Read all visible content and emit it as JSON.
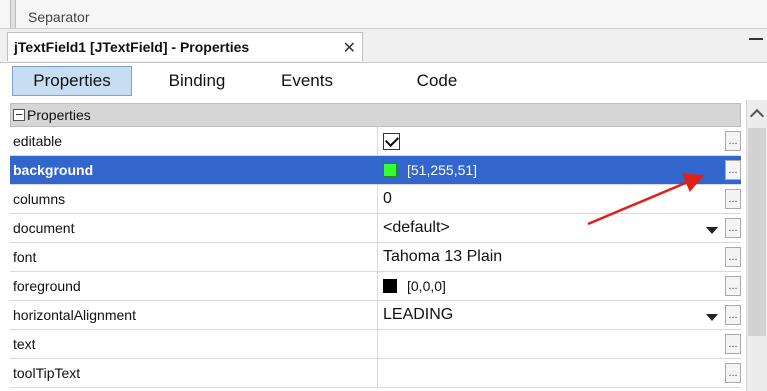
{
  "top_strip": {
    "cut_label": "Separator"
  },
  "window_tab": {
    "title": "jTextField1 [JTextField] - Properties",
    "close": "✕"
  },
  "sub_tabs": [
    {
      "label": "Properties",
      "active": true
    },
    {
      "label": "Binding",
      "active": false
    },
    {
      "label": "Events",
      "active": false
    },
    {
      "label": "Code",
      "active": false
    }
  ],
  "section": {
    "title": "Properties"
  },
  "rows": [
    {
      "name": "editable",
      "value": "",
      "type": "checkbox",
      "checked": true
    },
    {
      "name": "background",
      "value": "[51,255,51]",
      "type": "color",
      "color": "#33ff33",
      "selected": true
    },
    {
      "name": "columns",
      "value": "0",
      "type": "text"
    },
    {
      "name": "document",
      "value": "<default>",
      "type": "dropdown"
    },
    {
      "name": "font",
      "value": "Tahoma 13 Plain",
      "type": "text"
    },
    {
      "name": "foreground",
      "value": "[0,0,0]",
      "type": "color",
      "color": "#000000"
    },
    {
      "name": "horizontalAlignment",
      "value": "LEADING",
      "type": "dropdown"
    },
    {
      "name": "text",
      "value": "",
      "type": "text"
    },
    {
      "name": "toolTipText",
      "value": "",
      "type": "text"
    }
  ],
  "ellipsis_label": "...",
  "colors": {
    "selection": "#3366cc",
    "arrow": "#e0201b",
    "active_tab": "#c7ddf2"
  }
}
